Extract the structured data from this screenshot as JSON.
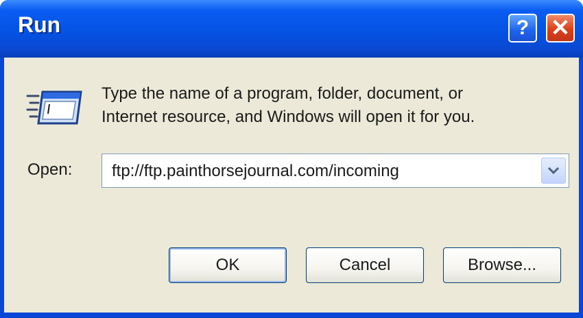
{
  "window": {
    "title": "Run",
    "help_glyph": "?",
    "close_glyph": "✕"
  },
  "icons": {
    "run_program": "run-program-icon",
    "dropdown": "chevron-down-icon",
    "help": "help-icon",
    "close": "close-icon"
  },
  "description": {
    "line1": "Type the name of a program, folder, document, or",
    "line2": "Internet resource, and Windows will open it for you."
  },
  "open_field": {
    "label": "Open:",
    "value": "ftp://ftp.painthorsejournal.com/incoming"
  },
  "buttons": {
    "ok": "OK",
    "cancel": "Cancel",
    "browse": "Browse..."
  },
  "colors": {
    "titlebar": "#0552e4",
    "client_bg": "#ece9d8",
    "close_red": "#d9401a"
  }
}
